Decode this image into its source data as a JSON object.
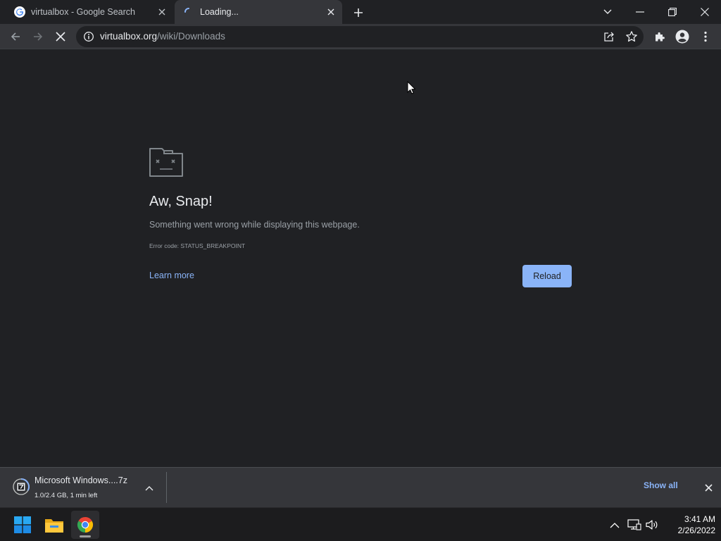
{
  "tabs": [
    {
      "title": "virtualbox - Google Search",
      "favicon": "google-icon",
      "active": false
    },
    {
      "title": "Loading...",
      "favicon": "loading-spinner-icon",
      "active": true
    }
  ],
  "window_controls": [
    "tab-search-icon",
    "minimize-icon",
    "restore-icon",
    "close-icon"
  ],
  "address_bar": {
    "host": "virtualbox.org",
    "path": "/wiki/Downloads"
  },
  "error_page": {
    "heading": "Aw, Snap!",
    "message": "Something went wrong while displaying this webpage.",
    "error_code": "Error code: STATUS_BREAKPOINT",
    "learn_more": "Learn more",
    "reload": "Reload"
  },
  "download_shelf": {
    "filename": "Microsoft Windows....7z",
    "status": "1.0/2.4 GB, 1 min left",
    "progress": 0.42,
    "show_all": "Show all"
  },
  "taskbar": {
    "apps": [
      "start-icon",
      "file-explorer-icon",
      "chrome-icon"
    ],
    "time": "3:41 AM",
    "date": "2/26/2022"
  },
  "colors": {
    "page_bg": "#202124",
    "toolbar_bg": "#35363a",
    "accent": "#8ab4f8",
    "taskbar_bg": "#1c1c1e"
  }
}
